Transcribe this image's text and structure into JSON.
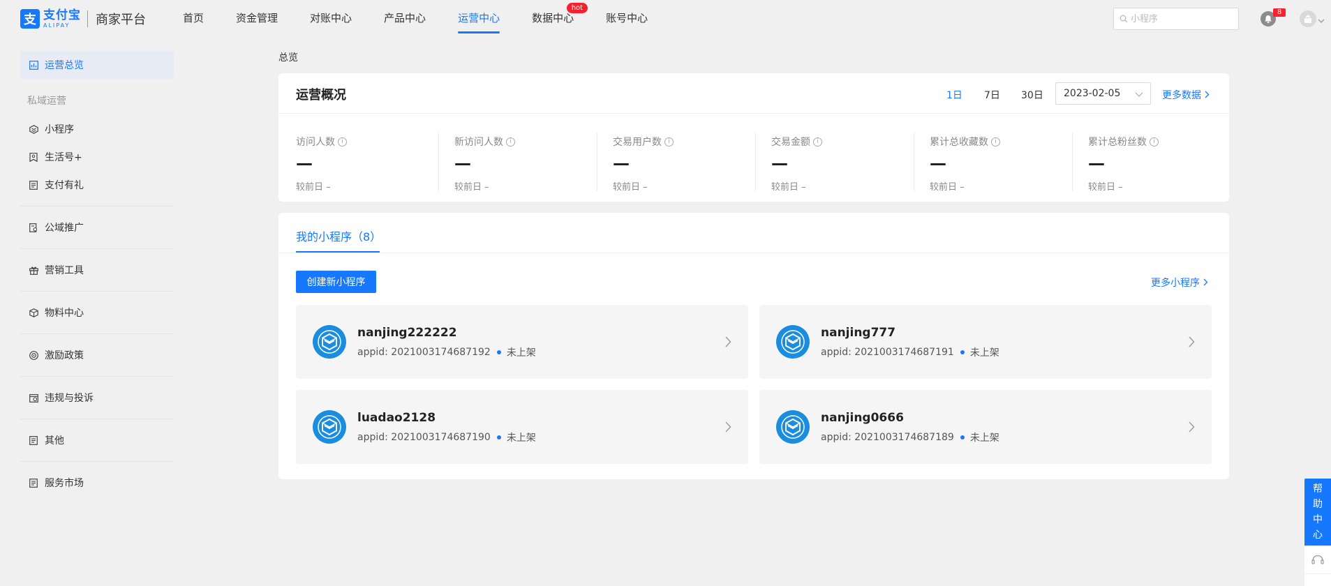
{
  "header": {
    "logo_cn": "支付宝",
    "logo_en": "ALIPAY",
    "platform": "商家平台",
    "nav": [
      {
        "label": "首页"
      },
      {
        "label": "资金管理"
      },
      {
        "label": "对账中心"
      },
      {
        "label": "产品中心"
      },
      {
        "label": "运营中心",
        "active": true
      },
      {
        "label": "数据中心",
        "badge": "hot"
      },
      {
        "label": "账号中心"
      }
    ],
    "search_placeholder": "小程序",
    "notification_count": "8"
  },
  "sidebar": {
    "active": {
      "label": "运营总览",
      "icon": "chart-icon"
    },
    "group_title": "私域运营",
    "group_items": [
      {
        "label": "小程序",
        "icon": "miniapp-icon"
      },
      {
        "label": "生活号+",
        "icon": "bookmark-icon"
      },
      {
        "label": "支付有礼",
        "icon": "document-icon"
      }
    ],
    "items": [
      {
        "label": "公域推广",
        "icon": "promote-icon"
      },
      {
        "label": "营销工具",
        "icon": "gift-icon"
      },
      {
        "label": "物料中心",
        "icon": "box-icon"
      },
      {
        "label": "激励政策",
        "icon": "target-icon"
      },
      {
        "label": "违规与投诉",
        "icon": "calendar-icon"
      },
      {
        "label": "其他",
        "icon": "document-icon"
      },
      {
        "label": "服务市场",
        "icon": "document-icon"
      }
    ]
  },
  "main": {
    "breadcrumb": "总览",
    "overview": {
      "title": "运营概况",
      "ranges": [
        "1日",
        "7日",
        "30日"
      ],
      "active_range": "1日",
      "date": "2023-02-05",
      "more": "更多数据",
      "metrics": [
        {
          "label": "访问人数",
          "value": "—",
          "compare": "较前日 –"
        },
        {
          "label": "新访问人数",
          "value": "—",
          "compare": "较前日 –"
        },
        {
          "label": "交易用户数",
          "value": "—",
          "compare": "较前日 –"
        },
        {
          "label": "交易金额",
          "value": "—",
          "compare": "较前日 –"
        },
        {
          "label": "累计总收藏数",
          "value": "—",
          "compare": "较前日 –"
        },
        {
          "label": "累计总粉丝数",
          "value": "—",
          "compare": "较前日 –"
        }
      ]
    },
    "mini_programs": {
      "tab_label": "我的小程序（8）",
      "create_button": "创建新小程序",
      "more": "更多小程序",
      "apps": [
        {
          "name": "nanjing222222",
          "appid": "appid: 2021003174687192",
          "status": "未上架"
        },
        {
          "name": "nanjing777",
          "appid": "appid: 2021003174687191",
          "status": "未上架"
        },
        {
          "name": "luadao2128",
          "appid": "appid: 2021003174687190",
          "status": "未上架"
        },
        {
          "name": "nanjing0666",
          "appid": "appid: 2021003174687189",
          "status": "未上架"
        }
      ]
    }
  },
  "help": {
    "chars": [
      "帮",
      "助",
      "中",
      "心"
    ]
  },
  "colors": {
    "accent": "#1677ff",
    "badge": "#f5222d",
    "background": "#f0f0f0"
  }
}
